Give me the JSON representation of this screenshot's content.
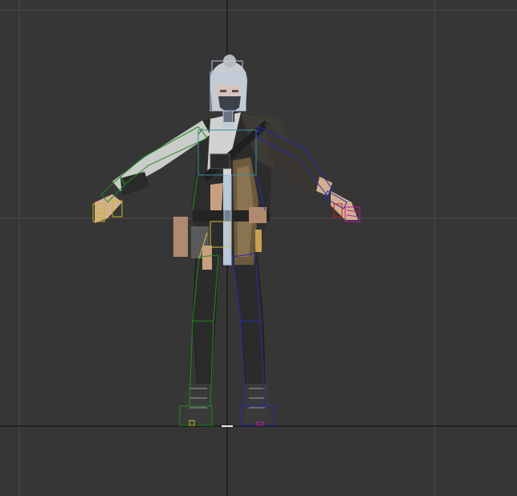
{
  "viewport": {
    "background": "#363636",
    "grid_color": "#4a4a4a",
    "axis_color": "#000000"
  },
  "character": {
    "description_icon": "character-rig-icon",
    "bone_colors": {
      "head": "#b7c8e6",
      "spine": "#3a8f9a",
      "left_arm": "#1f8a1f",
      "right_arm": "#2a2ab0",
      "left_hand": "#c8b81a",
      "right_hand": "#c01aa8",
      "left_leg": "#1f8a1f",
      "right_leg": "#2a2ab0",
      "pelvis": "#d8c040"
    }
  }
}
